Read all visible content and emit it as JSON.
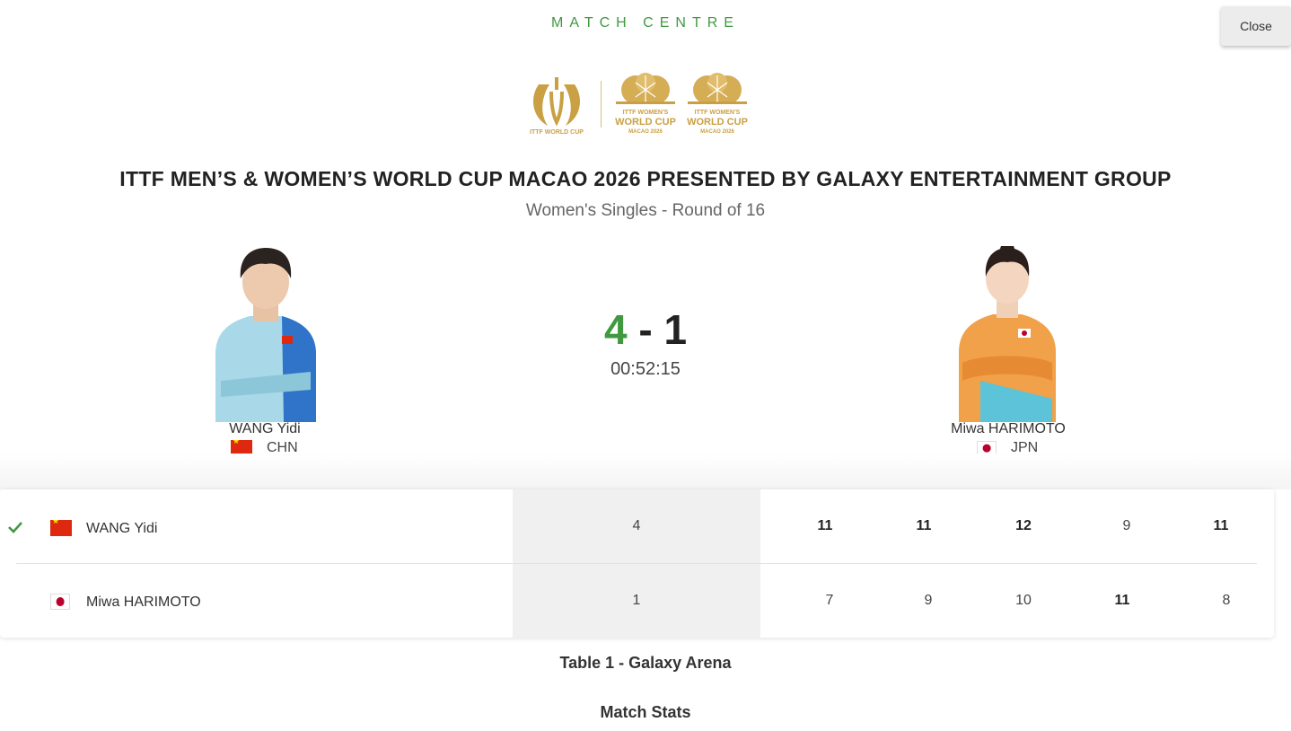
{
  "header": {
    "kicker": "MATCH CENTRE",
    "close_label": "Close"
  },
  "logos": {
    "main_caption": "ITTF WORLD CUP",
    "women_line1": "ITTF WOMEN'S",
    "women_line2": "WORLD CUP",
    "women_line3": "MACAO 2026",
    "brand_color": "#c9a043"
  },
  "event": {
    "title": "ITTF MEN’S & WOMEN’S WORLD CUP MACAO 2026 PRESENTED BY GALAXY ENTERTAINMENT GROUP",
    "subtitle": "Women's Singles - Round of 16"
  },
  "match": {
    "score_left": "4",
    "score_separator": "-",
    "score_right": "1",
    "duration": "00:52:15",
    "winner_color": "#3f9a3f"
  },
  "players": [
    {
      "name": "WANG Yidi",
      "country": "CHN",
      "flag": "china-flag",
      "winner": true,
      "games": "4",
      "sets": [
        "11",
        "11",
        "12",
        "9",
        "11"
      ],
      "set_won": [
        true,
        true,
        true,
        false,
        true
      ]
    },
    {
      "name": "Miwa HARIMOTO",
      "country": "JPN",
      "flag": "japan-flag",
      "winner": false,
      "games": "1",
      "sets": [
        "7",
        "9",
        "10",
        "11",
        "8"
      ],
      "set_won": [
        false,
        false,
        false,
        true,
        false
      ]
    }
  ],
  "footer": {
    "venue": "Table 1 - Galaxy Arena",
    "stats_label": "Match Stats"
  }
}
